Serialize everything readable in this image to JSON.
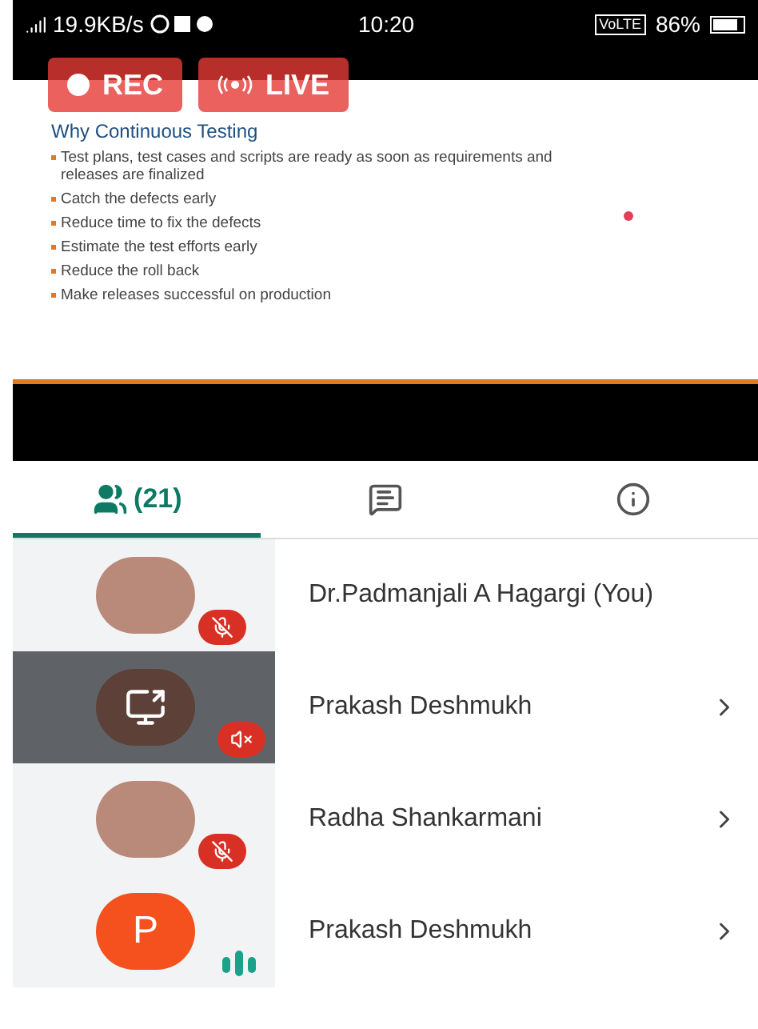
{
  "status_bar": {
    "speed": "19.9KB/s",
    "time": "10:20",
    "network_badge": "VoLTE",
    "battery": "86%"
  },
  "stream": {
    "rec_label": "REC",
    "live_label": "LIVE",
    "slide": {
      "title": "Why Continuous Testing",
      "bullets": [
        "Test plans, test cases and scripts are ready as soon as requirements and releases are finalized",
        "Catch the defects early",
        "Reduce time to fix the defects",
        "Estimate the test efforts early",
        "Reduce the roll back",
        "Make releases successful on production"
      ]
    }
  },
  "tabs": [
    {
      "kind": "people",
      "label": "(21)",
      "selected": true
    },
    {
      "kind": "chat",
      "selected": false
    },
    {
      "kind": "info",
      "selected": false
    }
  ],
  "participants": [
    {
      "name": "Dr.Padmanjali A Hagargi (You)",
      "avatar": {
        "kind": "photo"
      },
      "audio": {
        "kind": "mic_off"
      },
      "selected": false,
      "has_arrow": false
    },
    {
      "name": "Prakash Deshmukh",
      "avatar": {
        "kind": "screen"
      },
      "audio": {
        "kind": "sound_off"
      },
      "selected": true,
      "has_arrow": true
    },
    {
      "name": "Radha Shankarmani",
      "avatar": {
        "kind": "photo"
      },
      "audio": {
        "kind": "mic_off"
      },
      "selected": false,
      "has_arrow": true
    },
    {
      "name": "Prakash Deshmukh",
      "avatar": {
        "kind": "letter",
        "initial": "P"
      },
      "audio": {
        "kind": "speaking"
      },
      "selected": false,
      "has_arrow": true
    }
  ]
}
